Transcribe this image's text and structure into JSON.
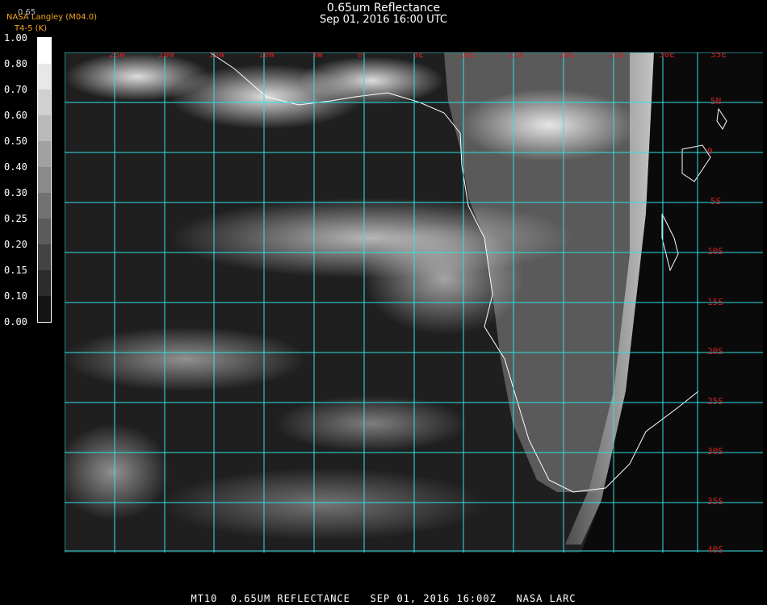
{
  "header": {
    "title": "0.65um Reflectance",
    "subtitle": "Sep 01, 2016 16:00 UTC",
    "credit_top": "0.65",
    "credit_line1": "NASA Langley (M04.0)",
    "credit_line2": "T4-5 (K)"
  },
  "colorbar": {
    "labels": [
      "1.00",
      "0.80",
      "0.70",
      "0.60",
      "0.50",
      "0.40",
      "0.30",
      "0.25",
      "0.20",
      "0.15",
      "0.10",
      "0.00"
    ]
  },
  "map": {
    "grid_color": "#33e0e6",
    "label_color": "#cc2222",
    "longitude_labels": [
      "25W",
      "20W",
      "15W",
      "10W",
      "5W",
      "0",
      "5E",
      "10E",
      "15E",
      "20E",
      "25E",
      "30E",
      "35E"
    ],
    "latitude_labels": [
      "5N",
      "0",
      "5S",
      "10S",
      "15S",
      "20S",
      "25S",
      "30S",
      "35S",
      "40S"
    ]
  },
  "footer": {
    "text": "MT10  0.65UM REFLECTANCE   SEP 01, 2016 16:00Z   NASA LARC"
  }
}
